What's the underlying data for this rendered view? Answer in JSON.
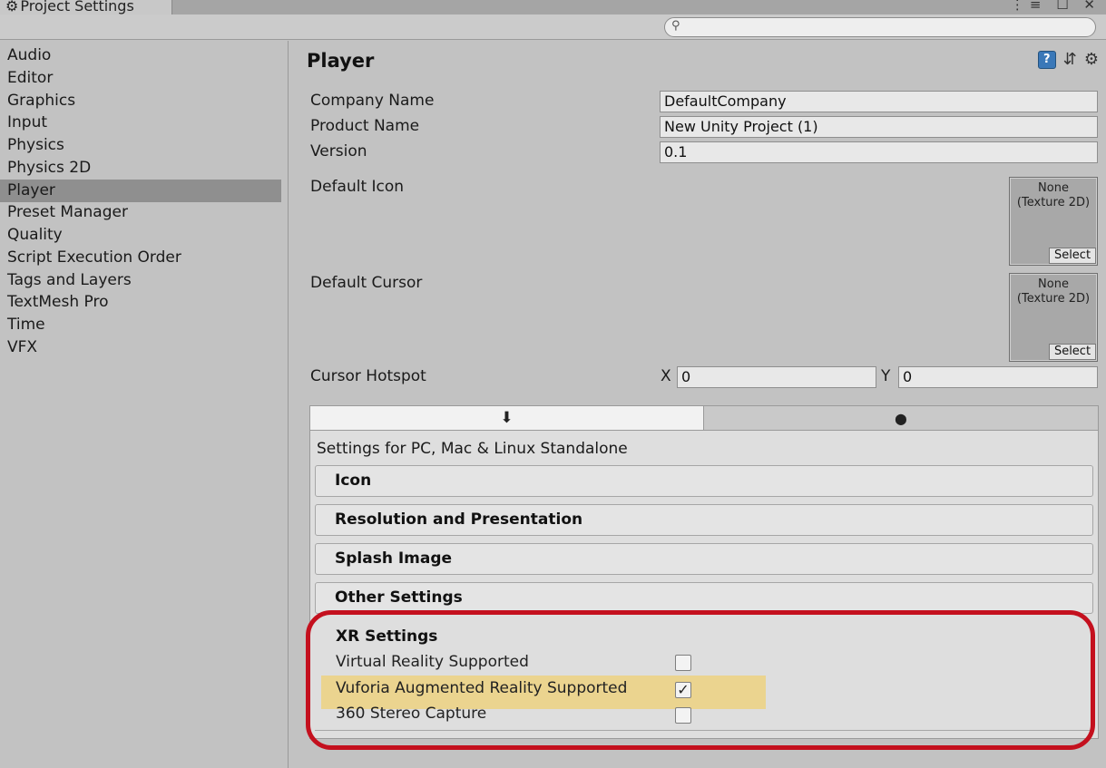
{
  "window": {
    "tab_title": "Project Settings",
    "controls": "⋮≡ ☐ ✕"
  },
  "sidebar": {
    "items": [
      {
        "label": "Audio"
      },
      {
        "label": "Editor"
      },
      {
        "label": "Graphics"
      },
      {
        "label": "Input"
      },
      {
        "label": "Physics"
      },
      {
        "label": "Physics 2D"
      },
      {
        "label": "Player"
      },
      {
        "label": "Preset Manager"
      },
      {
        "label": "Quality"
      },
      {
        "label": "Script Execution Order"
      },
      {
        "label": "Tags and Layers"
      },
      {
        "label": "TextMesh Pro"
      },
      {
        "label": "Time"
      },
      {
        "label": "VFX"
      }
    ],
    "selected": "Player"
  },
  "main": {
    "title": "Player",
    "icons": [
      "help-icon",
      "preset-icon",
      "gear-icon"
    ],
    "fields": {
      "company": {
        "label": "Company Name",
        "value": "DefaultCompany"
      },
      "product": {
        "label": "Product Name",
        "value": "New Unity Project (1)"
      },
      "version": {
        "label": "Version",
        "value": "0.1"
      }
    },
    "default_icon": {
      "label": "Default Icon",
      "line1": "None",
      "line2": "(Texture 2D)",
      "select": "Select"
    },
    "default_cursor": {
      "label": "Default Cursor",
      "line1": "None",
      "line2": "(Texture 2D)",
      "select": "Select"
    },
    "hotspot": {
      "label": "Cursor Hotspot",
      "x_label": "X",
      "x_value": "0",
      "y_label": "Y",
      "y_value": "0"
    }
  },
  "platform": {
    "tabs": [
      {
        "icon": "download-arrow-icon",
        "glyph": "⬇"
      },
      {
        "icon": "android-icon",
        "glyph": "⬤"
      }
    ],
    "title": "Settings for PC, Mac & Linux Standalone",
    "sections": [
      "Icon",
      "Resolution and Presentation",
      "Splash Image",
      "Other Settings"
    ],
    "xr": {
      "title": "XR Settings",
      "rows": [
        {
          "label": "Virtual Reality Supported",
          "checked": false,
          "mark": ""
        },
        {
          "label": "Vuforia Augmented Reality Supported",
          "checked": true,
          "mark": "✓"
        },
        {
          "label": "360 Stereo Capture",
          "checked": false,
          "mark": ""
        }
      ]
    }
  },
  "colors": {
    "highlight": "#ebd48f",
    "annotation_ring": "#c4101e",
    "selected_item": "#8f8f8f"
  }
}
